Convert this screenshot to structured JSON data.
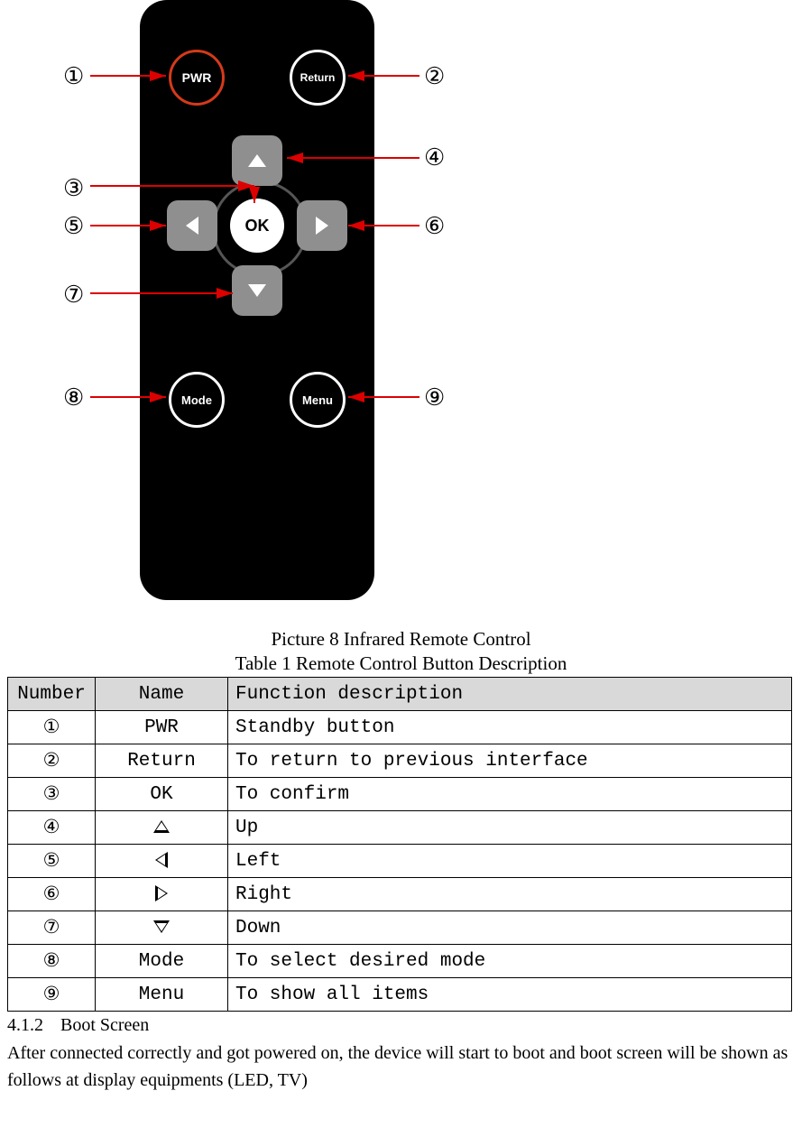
{
  "picture_caption": "Picture 8 Infrared Remote Control",
  "table_caption": "Table 1 Remote Control Button Description",
  "remote": {
    "pwr": "PWR",
    "return": "Return",
    "ok": "OK",
    "mode": "Mode",
    "menu": "Menu"
  },
  "callouts": {
    "c1": "①",
    "c2": "②",
    "c3": "③",
    "c4": "④",
    "c5": "⑤",
    "c6": "⑥",
    "c7": "⑦",
    "c8": "⑧",
    "c9": "⑨"
  },
  "table": {
    "headers": {
      "number": "Number",
      "name": "Name",
      "desc": "Function description"
    },
    "rows": [
      {
        "number": "①",
        "name": "PWR",
        "name_type": "text",
        "desc": "Standby button"
      },
      {
        "number": "②",
        "name": "Return",
        "name_type": "text",
        "desc": "To return to previous interface"
      },
      {
        "number": "③",
        "name": "OK",
        "name_type": "text",
        "desc": "To confirm"
      },
      {
        "number": "④",
        "name": "up",
        "name_type": "tri",
        "desc": "Up"
      },
      {
        "number": "⑤",
        "name": "left",
        "name_type": "tri",
        "desc": "Left"
      },
      {
        "number": "⑥",
        "name": "right",
        "name_type": "tri",
        "desc": "Right"
      },
      {
        "number": "⑦",
        "name": "down",
        "name_type": "tri",
        "desc": "Down"
      },
      {
        "number": "⑧",
        "name": "Mode",
        "name_type": "text",
        "desc": "To select desired mode"
      },
      {
        "number": "⑨",
        "name": "Menu",
        "name_type": "text",
        "desc": "To show all items"
      }
    ]
  },
  "section_num": "4.1.2",
  "section_title": "Boot Screen",
  "paragraph": "After connected correctly and got powered on, the device will start to boot and boot screen will be shown as follows at display equipments (LED, TV)"
}
